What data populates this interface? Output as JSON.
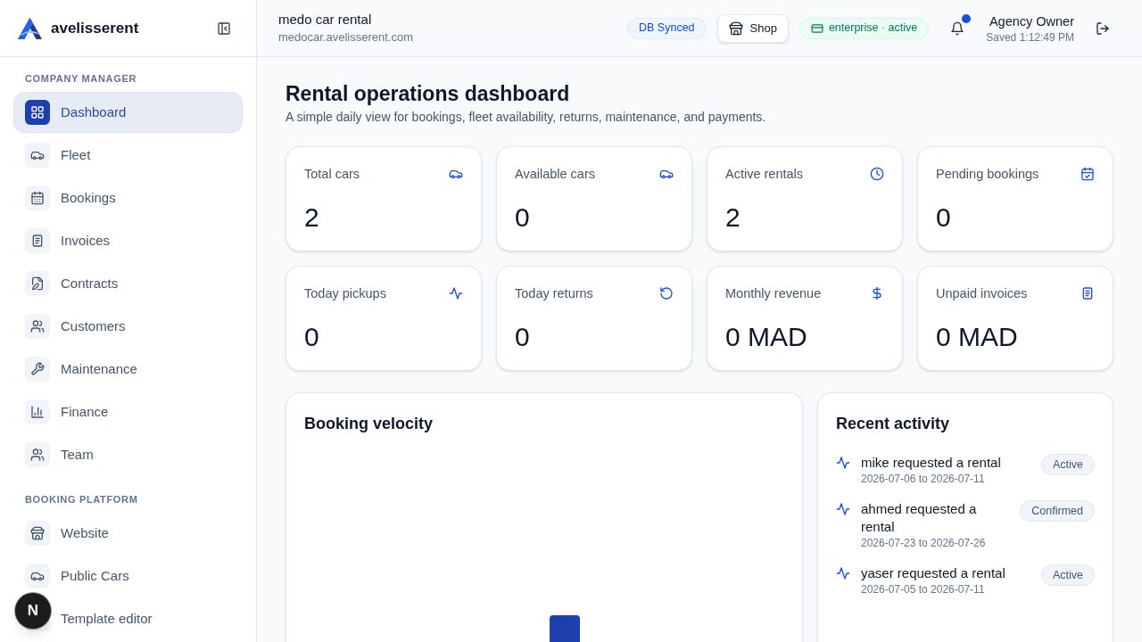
{
  "sidebar": {
    "brand": "avelisserent",
    "sections": [
      {
        "title": "COMPANY MANAGER",
        "items": [
          {
            "label": "Dashboard",
            "selected": true
          },
          {
            "label": "Fleet",
            "selected": false
          },
          {
            "label": "Bookings",
            "selected": false
          },
          {
            "label": "Invoices",
            "selected": false
          },
          {
            "label": "Contracts",
            "selected": false
          },
          {
            "label": "Customers",
            "selected": false
          },
          {
            "label": "Maintenance",
            "selected": false
          },
          {
            "label": "Finance",
            "selected": false
          },
          {
            "label": "Team",
            "selected": false
          }
        ]
      },
      {
        "title": "BOOKING PLATFORM",
        "items": [
          {
            "label": "Website",
            "selected": false
          },
          {
            "label": "Public Cars",
            "selected": false
          },
          {
            "label": "Template editor",
            "selected": false
          }
        ]
      }
    ]
  },
  "header": {
    "company": "medo car rental",
    "domain": "medocar.avelisserent.com",
    "sync_badge": "DB Synced",
    "shop_button": "Shop",
    "plan_badge": "enterprise · active",
    "notifications": {
      "unread": true
    },
    "user": {
      "name": "Agency Owner",
      "saved": "Saved 1:12:49 PM"
    }
  },
  "page": {
    "title": "Rental operations dashboard",
    "subtitle": "A simple daily view for bookings, fleet availability, returns, maintenance, and payments."
  },
  "stats": [
    {
      "label": "Total cars",
      "value": "2"
    },
    {
      "label": "Available cars",
      "value": "0"
    },
    {
      "label": "Active rentals",
      "value": "2"
    },
    {
      "label": "Pending bookings",
      "value": "0"
    },
    {
      "label": "Today pickups",
      "value": "0"
    },
    {
      "label": "Today returns",
      "value": "0"
    },
    {
      "label": "Monthly revenue",
      "value": "0 MAD"
    },
    {
      "label": "Unpaid invoices",
      "value": "0 MAD"
    }
  ],
  "booking_velocity": {
    "title": "Booking velocity"
  },
  "recent_activity": {
    "title": "Recent activity",
    "items": [
      {
        "text": "mike requested a rental",
        "dates": "2026-07-06 to 2026-07-11",
        "status": "Active"
      },
      {
        "text": "ahmed requested a rental",
        "dates": "2026-07-23 to 2026-07-26",
        "status": "Confirmed"
      },
      {
        "text": "yaser requested a rental",
        "dates": "2026-07-05 to 2026-07-11",
        "status": "Active"
      }
    ]
  },
  "dev_badge": {
    "label": "N"
  }
}
